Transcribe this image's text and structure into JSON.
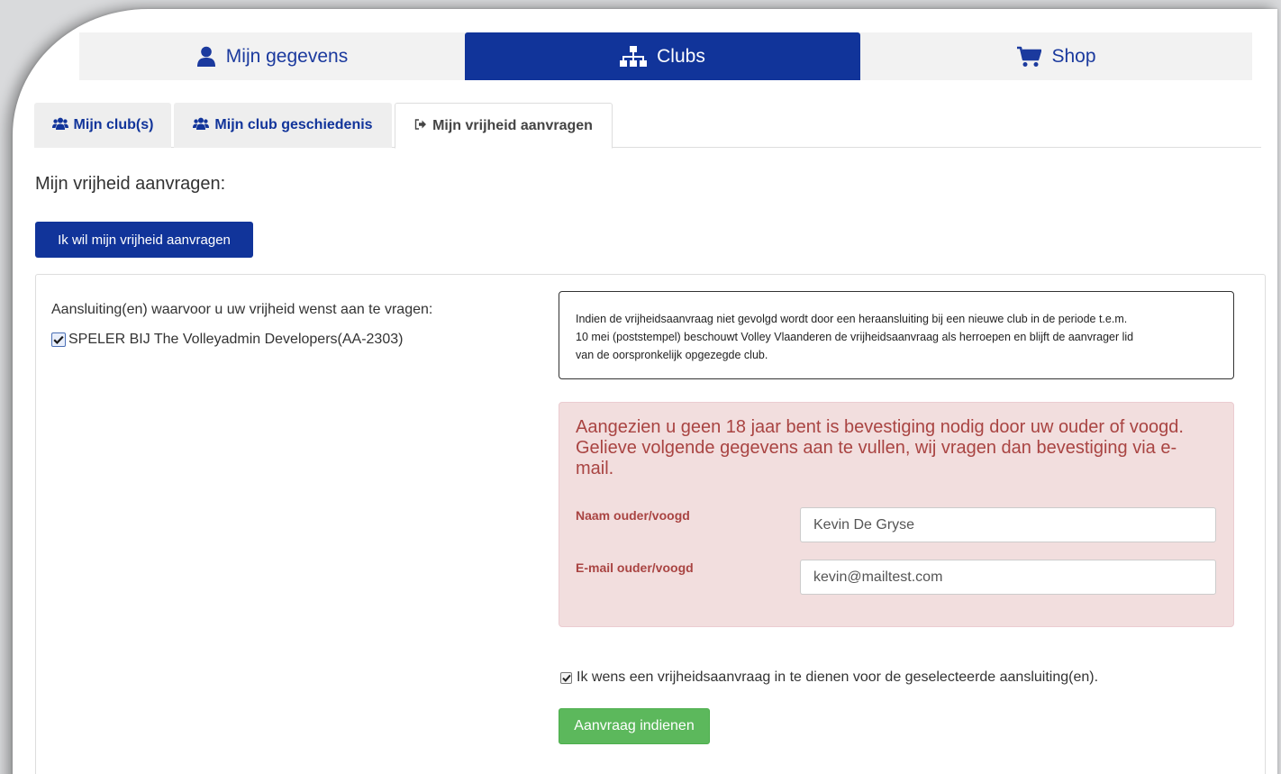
{
  "topnav": {
    "items": [
      {
        "label": "Mijn gegevens",
        "icon": "user-icon",
        "active": false
      },
      {
        "label": "Clubs",
        "icon": "sitemap-icon",
        "active": true
      },
      {
        "label": "Shop",
        "icon": "cart-icon",
        "active": false
      }
    ]
  },
  "tabs": [
    {
      "label": "Mijn club(s)",
      "icon": "users-icon",
      "active": false
    },
    {
      "label": "Mijn club geschiedenis",
      "icon": "users-icon",
      "active": false
    },
    {
      "label": "Mijn vrijheid aanvragen",
      "icon": "sign-out-icon",
      "active": true
    }
  ],
  "page": {
    "heading": "Mijn vrijheid aanvragen:",
    "request_button": "Ik wil mijn vrijheid aanvragen"
  },
  "affiliations": {
    "label": "Aansluiting(en) waarvoor u uw vrijheid wenst aan te vragen:",
    "items": [
      {
        "label": "SPELER BIJ The Volleyadmin Developers(AA-2303)",
        "checked": true
      }
    ]
  },
  "notice": {
    "line1": "Indien de vrijheidsaanvraag niet gevolgd wordt door een heraansluiting bij een nieuwe club in de periode t.e.m.",
    "line2": "10 mei (poststempel) beschouwt Volley Vlaanderen de vrijheidsaanvraag als herroepen en blijft de aanvrager lid",
    "line3": "van de oorspronkelijk opgezegde club."
  },
  "guardian": {
    "message": "Aangezien u geen 18 jaar bent is bevestiging nodig door uw ouder of voogd. Gelieve volgende gegevens aan te vullen, wij vragen dan bevestiging via e-mail.",
    "name_label": "Naam ouder/voogd",
    "name_value": "Kevin De Gryse",
    "email_label": "E-mail ouder/voogd",
    "email_value": "kevin@mailtest.com"
  },
  "confirm": {
    "label": "Ik wens een vrijheidsaanvraag in te dienen voor de geselecteerde aansluiting(en).",
    "checked": true
  },
  "submit_button": "Aanvraag indienen",
  "colors": {
    "primary": "#11349a",
    "success": "#5cb85c",
    "alert_bg": "#f2dede",
    "alert_text": "#a94442"
  }
}
